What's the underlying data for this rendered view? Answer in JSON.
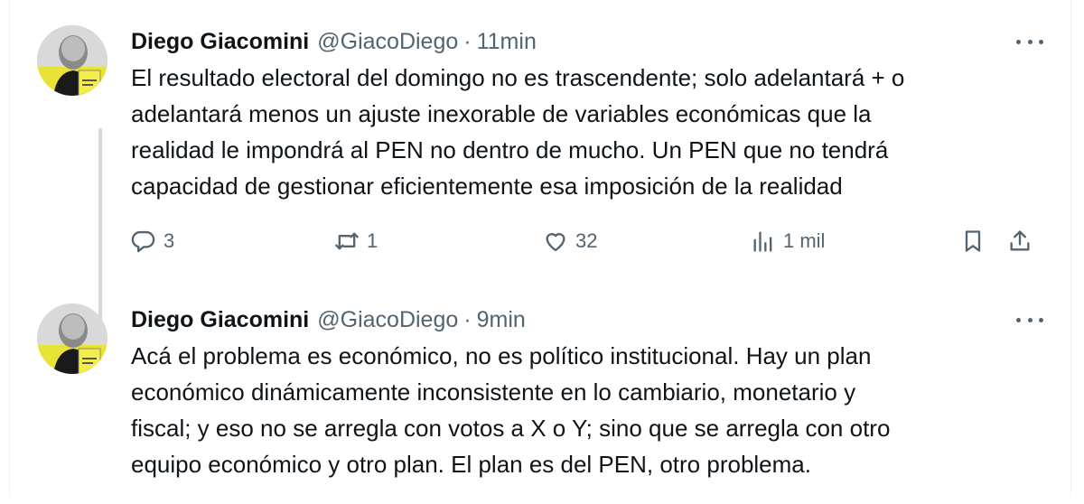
{
  "tweets": [
    {
      "author_name": "Diego Giacomini",
      "handle": "@GiacoDiego",
      "separator": "·",
      "time": "11min",
      "text": "El resultado electoral del domingo no es trascendente; solo adelantará + o\nadelantará menos un ajuste inexorable de variables económicas que la\nrealidad le impondrá al PEN no dentro de mucho. Un PEN que no tendrá\ncapacidad de gestionar eficientemente esa imposición de la realidad",
      "replies": "3",
      "retweets": "1",
      "likes": "32",
      "views": "1 mil"
    },
    {
      "author_name": "Diego Giacomini",
      "handle": "@GiacoDiego",
      "separator": "·",
      "time": "9min",
      "text": "Acá el problema es económico, no es político institucional. Hay un plan\neconómico dinámicamente inconsistente en lo cambiario, monetario y\nfiscal; y eso no se arregla con votos a X o Y; sino que se arregla con otro\nequipo económico y otro plan. El plan es del PEN, otro problema."
    }
  ],
  "icons": {
    "reply": "reply-icon",
    "retweet": "retweet-icon",
    "like": "like-icon",
    "views": "views-icon",
    "bookmark": "bookmark-icon",
    "share": "share-icon",
    "more": "more-icon"
  },
  "colors": {
    "text_primary": "#0f1419",
    "text_secondary": "#536471",
    "thread_line": "#cfd9de",
    "avatar_accent": "#e8e337"
  }
}
